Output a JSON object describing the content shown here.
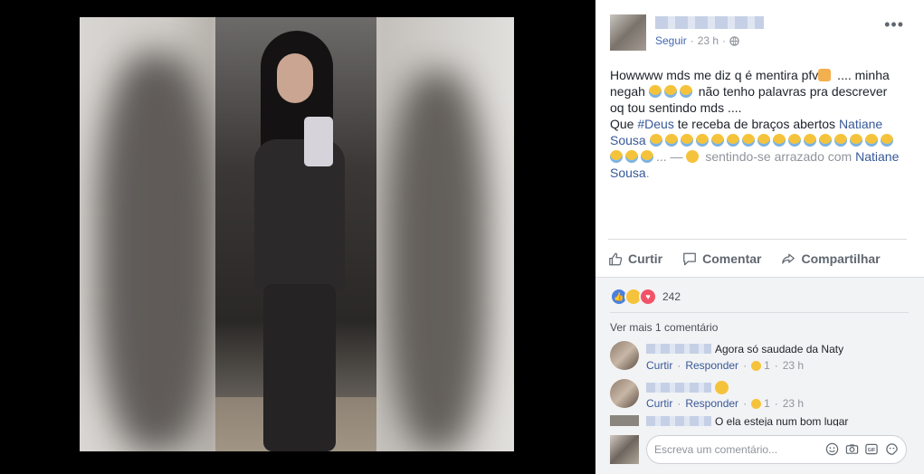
{
  "post": {
    "follow": "Seguir",
    "time": "23 h",
    "more": "•••",
    "text": {
      "line1_a": "Howwww mds me diz q é mentira pfv",
      "line1_b": " .... minha",
      "line2_a": "negah ",
      "line2_b": " não tenho palavras pra descrever",
      "line3": "oq tou sentindo mds ....",
      "line4_a": "Que ",
      "hashtag": "#Deus",
      "line4_b": " te receba de braços abertos ",
      "tag_name": "Natiane Sousa",
      "ellipsis": "... — ",
      "feeling": " sentindo-se arrazado com ",
      "tag_name_2": "Natiane Sousa",
      "end": "."
    }
  },
  "actions": {
    "like": "Curtir",
    "comment": "Comentar",
    "share": "Compartilhar"
  },
  "reactions": {
    "count": "242"
  },
  "comments": {
    "see_more": "Ver mais 1 comentário",
    "items": [
      {
        "text": "Agora só saudade da Naty",
        "like": "Curtir",
        "reply": "Responder",
        "reaction_count": "1",
        "time": "23 h"
      },
      {
        "text": "",
        "like": "Curtir",
        "reply": "Responder",
        "reaction_count": "1",
        "time": "23 h"
      }
    ],
    "partial_text": "O ela esteja num bom lugar"
  },
  "composer": {
    "placeholder": "Escreva um comentário..."
  },
  "icons": [
    "thumb-up-icon",
    "comment-bubble-icon",
    "share-arrow-icon",
    "smile-icon",
    "camera-icon",
    "gif-icon",
    "sticker-icon",
    "globe-icon"
  ],
  "colors": {
    "link": "#385898",
    "follow": "#4267b2",
    "like": "#4a7fe0",
    "love": "#f25268",
    "emoji": "#f5c33b"
  }
}
